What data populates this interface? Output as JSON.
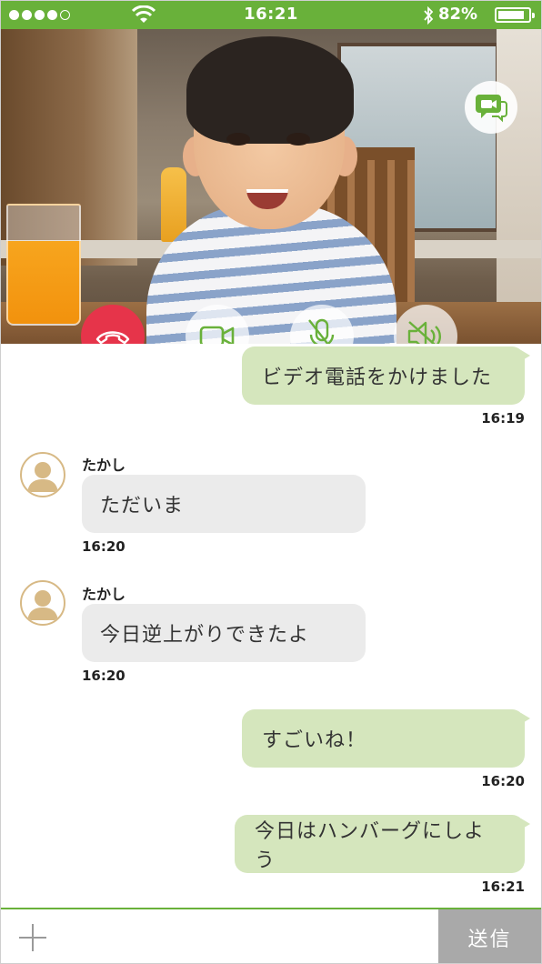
{
  "status_bar": {
    "signal_bars_filled": 4,
    "signal_bars_total": 5,
    "time": "16:21",
    "battery_percent": "82%",
    "battery_level": 0.82,
    "color": "#69b13a"
  },
  "call_controls": {
    "video_chat": "video-chat-icon",
    "end_call": "phone-hangup-icon",
    "camera": "video-camera-icon",
    "mic_muted": "mic-off-icon",
    "speaker_muted": "speaker-off-icon",
    "end_color": "#e6344a",
    "accent_color": "#69b13a"
  },
  "messages": [
    {
      "direction": "out",
      "text": "ビデオ電話をかけました",
      "time": "16:19"
    },
    {
      "direction": "in",
      "sender": "たかし",
      "text": "ただいま",
      "time": "16:20"
    },
    {
      "direction": "in",
      "sender": "たかし",
      "text": "今日逆上がりできたよ",
      "time": "16:20"
    },
    {
      "direction": "out",
      "text": "すごいね！",
      "time": "16:20"
    },
    {
      "direction": "out",
      "text": "今日はハンバーグにしよう",
      "time": "16:21"
    }
  ],
  "colors": {
    "outgoing_bubble": "#d5e6bd",
    "incoming_bubble": "#ebebeb"
  },
  "input_bar": {
    "attach_icon": "plus-icon",
    "send_label": "送信"
  }
}
